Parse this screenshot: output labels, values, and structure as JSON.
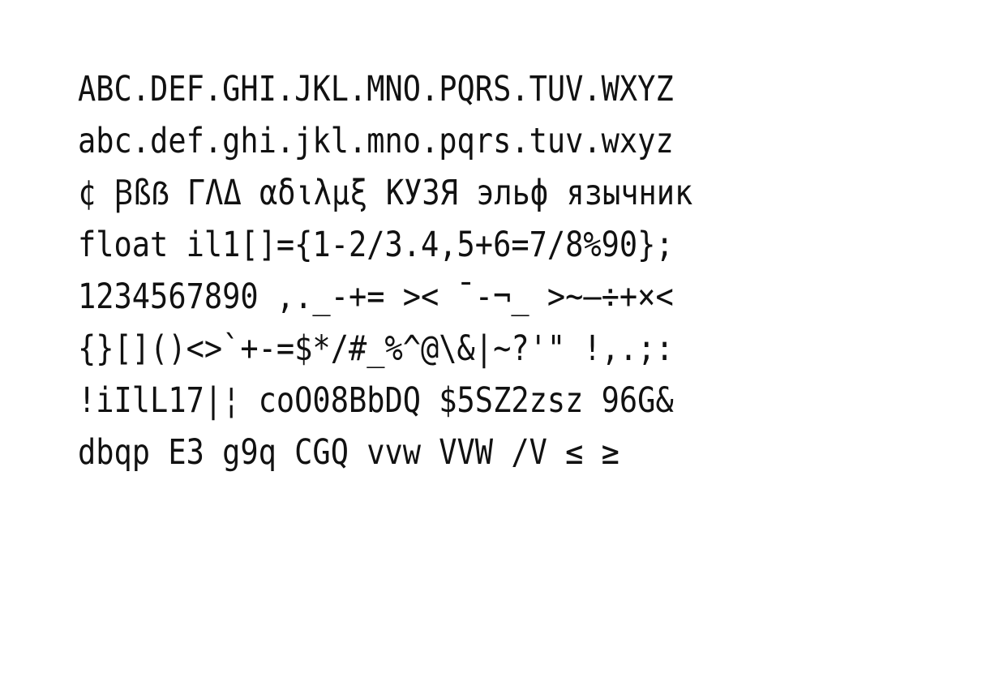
{
  "specimen": {
    "lines": [
      "ABC.DEF.GHI.JKL.MNO.PQRS.TUV.WXYZ",
      "abc.def.ghi.jkl.mno.pqrs.tuv.wxyz",
      "¢ Ꞵßẞ ΓΛΔ αδιλμξ КУЗЯ эльф язычник",
      "float il1[]={1-2/3.4,5+6=7/8%90};",
      "1234567890 ,._-+= >< ¯-¬_ >~–÷+×<",
      "{}[]()<>`+-=$*/#_%^@\\&|~?'\" !,.;:",
      "!iIlL17|¦ coO08BbDQ $5SZ2zsz 96G&",
      "dbqp E3 g9q CGQ vvw VVW /V ≤ ≥"
    ],
    "text_color": "#111111",
    "background_color": "#ffffff"
  }
}
